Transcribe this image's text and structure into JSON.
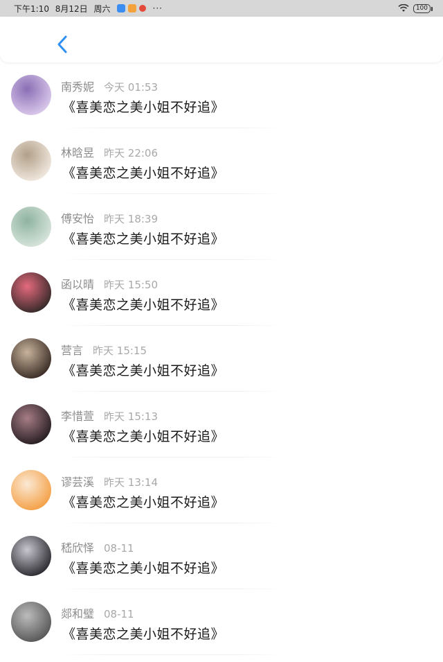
{
  "status_bar": {
    "time": "下午1:10",
    "date": "8月12日",
    "weekday": "周六",
    "more": "···",
    "battery": "100"
  },
  "messages": [
    {
      "name": "南秀妮",
      "time": "今天 01:53",
      "text": "《喜美恋之美小姐不好追》",
      "avatar_colors": [
        "#d8c6ea",
        "#8a6fb4"
      ]
    },
    {
      "name": "林晗昱",
      "time": "昨天 22:06",
      "text": "《喜美恋之美小姐不好追》",
      "avatar_colors": [
        "#efe6dc",
        "#b2a08a"
      ]
    },
    {
      "name": "傅安怡",
      "time": "昨天 18:39",
      "text": "《喜美恋之美小姐不好追》",
      "avatar_colors": [
        "#d5e3da",
        "#8fb3a0"
      ]
    },
    {
      "name": "函以晴",
      "time": "昨天 15:50",
      "text": "《喜美恋之美小姐不好追》",
      "avatar_colors": [
        "#3a2b2b",
        "#e56a7d"
      ]
    },
    {
      "name": "营言",
      "time": "昨天 15:15",
      "text": "《喜美恋之美小姐不好追》",
      "avatar_colors": [
        "#3e3029",
        "#c8b39b"
      ]
    },
    {
      "name": "李惜萱",
      "time": "昨天 15:13",
      "text": "《喜美恋之美小姐不好追》",
      "avatar_colors": [
        "#2a2025",
        "#a77d86"
      ]
    },
    {
      "name": "谬芸溪",
      "time": "昨天 13:14",
      "text": "《喜美恋之美小姐不好追》",
      "avatar_colors": [
        "#f4a24a",
        "#fbe9d5"
      ]
    },
    {
      "name": "嵇欣怿",
      "time": "08-11",
      "text": "《喜美恋之美小姐不好追》",
      "avatar_colors": [
        "#2f2f35",
        "#c8c6cf"
      ]
    },
    {
      "name": "郯和璧",
      "time": "08-11",
      "text": "《喜美恋之美小姐不好追》",
      "avatar_colors": [
        "#5a5a5a",
        "#bcbcbc"
      ]
    }
  ],
  "colors": {
    "accent": "#2f8ff2",
    "name_text": "#8c8c8c",
    "message_text": "#1a1a1a",
    "statusbar_bg": "#d7d7d7"
  }
}
